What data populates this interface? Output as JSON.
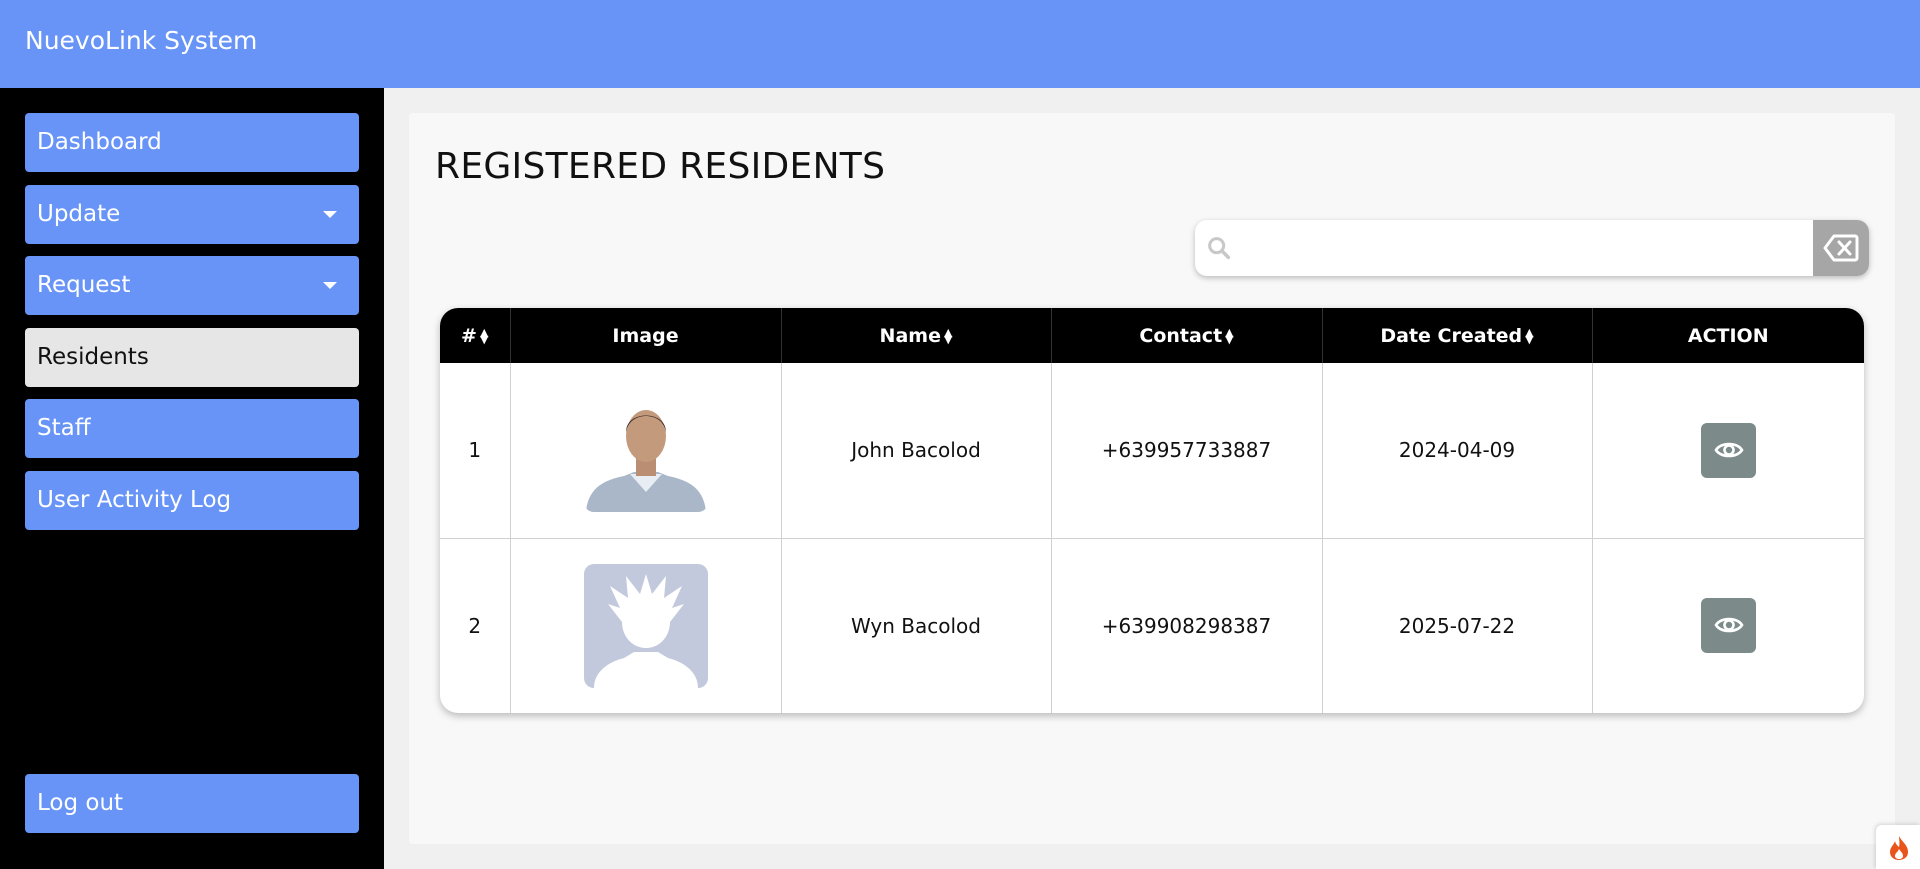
{
  "app": {
    "title": "NuevoLink System"
  },
  "sidebar": {
    "items": [
      {
        "label": "Dashboard",
        "has_caret": false,
        "active": false
      },
      {
        "label": "Update",
        "has_caret": true,
        "active": false
      },
      {
        "label": "Request",
        "has_caret": true,
        "active": false
      },
      {
        "label": "Residents",
        "has_caret": false,
        "active": true
      },
      {
        "label": "Staff",
        "has_caret": false,
        "active": false
      },
      {
        "label": "User Activity Log",
        "has_caret": false,
        "active": false
      }
    ],
    "logout_label": "Log out"
  },
  "main": {
    "title": "REGISTERED RESIDENTS",
    "search": {
      "value": "",
      "icon": "search-icon",
      "clear_icon": "backspace-icon"
    },
    "table": {
      "columns": [
        "#",
        "Image",
        "Name",
        "Contact",
        "Date Created",
        "ACTION"
      ],
      "rows": [
        {
          "num": "1",
          "name": "John Bacolod",
          "contact": "+639957733887",
          "date": "2024-04-09",
          "image": "resident-photo"
        },
        {
          "num": "2",
          "name": "Wyn Bacolod",
          "contact": "+639908298387",
          "date": "2025-07-22",
          "image": "default-avatar"
        }
      ]
    }
  },
  "colors": {
    "accent": "#6794f6",
    "sidebar_bg": "#000000",
    "active_item": "#e6e6e6",
    "view_button": "#7d8a8a",
    "avatar_placeholder": "#c3c9dc"
  }
}
